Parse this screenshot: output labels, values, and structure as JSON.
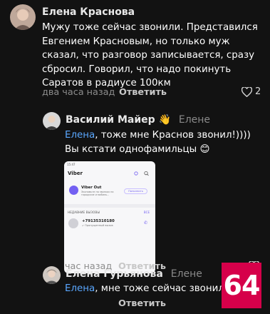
{
  "comments": [
    {
      "author": "Елена Краснова",
      "text_lines": [
        "Мужу тоже сейчас звонили. Представился",
        "Евгением Красновым, но только муж",
        "сказал, что разговор записывается, сразу",
        "сбросил. Говорил, что надо покинуть",
        "Саратов в радиусе 100км"
      ],
      "time": "два часа назад",
      "reply_label": "Ответить",
      "likes": "2"
    },
    {
      "author": "Василий Майер",
      "emoji": "👋",
      "reply_to": "Елене",
      "mention": "Елена",
      "text_line1_rest": ", тоже мне Краснов звонил!))))",
      "text_line2": "Вы кстати однофамильцы 😊",
      "time": "час назад",
      "reply_label": "Ответить",
      "attachment": {
        "status": "15:47",
        "brand": "Viber",
        "out_title": "Viber Out",
        "out_sub": "Экономьте на звонках на городские и мобиль...",
        "out_button": "Пополнить",
        "recent_label": "НЕДАВНИЕ ВЫЗОВЫ",
        "all_label": "ВСЕ",
        "call_number": "+79135310180",
        "call_sub": "↙ Пропущенный вызов"
      }
    },
    {
      "author": "Елена Гурьянова",
      "reply_to": "Елене",
      "mention": "Елена",
      "text_rest": ", мне тоже сейчас звонил",
      "reply_label": "Ответить"
    }
  ],
  "badge_text": "64",
  "colors": {
    "background": "#121212",
    "mention": "#5aa7ff",
    "badge": "#d6004a",
    "viber": "#7360f2"
  }
}
